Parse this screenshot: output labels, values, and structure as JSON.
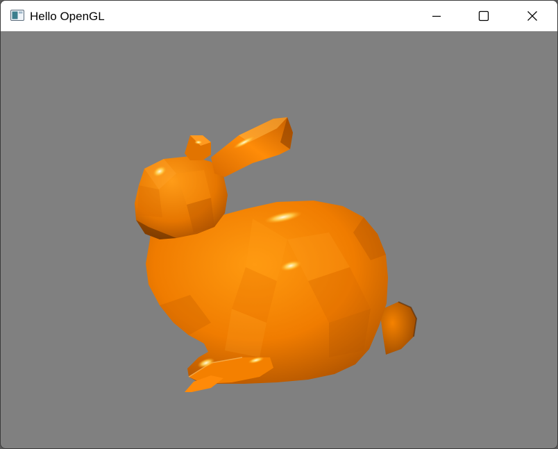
{
  "window": {
    "title": "Hello OpenGL",
    "icon": "app-window-icon",
    "controls": {
      "minimize_icon": "minimize-icon",
      "maximize_icon": "maximize-icon",
      "close_icon": "close-icon"
    }
  },
  "viewport": {
    "background_color": "#808080",
    "model_color": "#ff8400",
    "highlight_color": "#fff0a0"
  }
}
